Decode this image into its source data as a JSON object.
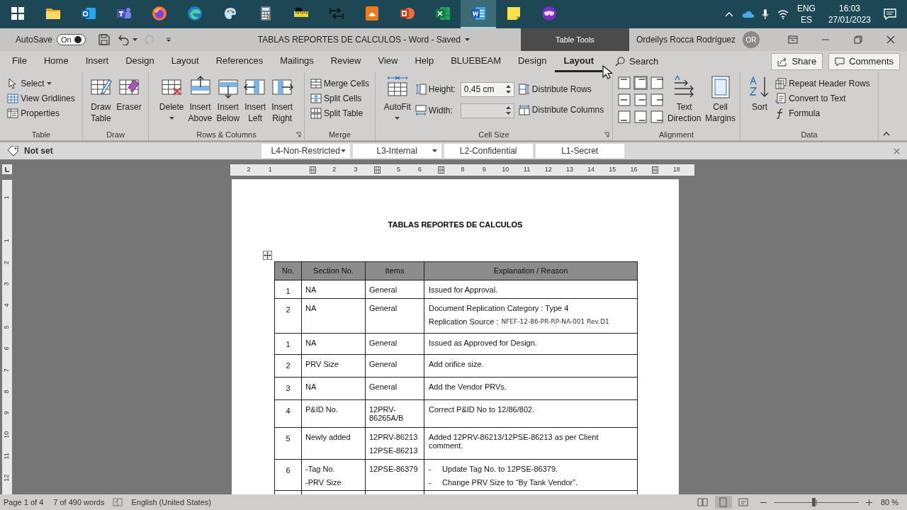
{
  "taskbar": {
    "apps": [
      {
        "kind": "start",
        "selected": false
      },
      {
        "kind": "folder",
        "selected": false
      },
      {
        "kind": "outlook",
        "selected": false
      },
      {
        "kind": "teams",
        "selected": false
      },
      {
        "kind": "firefox",
        "selected": false
      },
      {
        "kind": "edge",
        "selected": false
      },
      {
        "kind": "paint",
        "selected": false
      },
      {
        "kind": "calculator",
        "selected": false
      },
      {
        "kind": "ruler",
        "selected": false
      },
      {
        "kind": "tool",
        "selected": false
      },
      {
        "kind": "pdf",
        "selected": false
      },
      {
        "kind": "powerpoint",
        "selected": false
      },
      {
        "kind": "excel",
        "selected": false
      },
      {
        "kind": "word",
        "selected": true
      },
      {
        "kind": "sticky",
        "selected": false
      },
      {
        "kind": "mask",
        "selected": false
      }
    ],
    "language": "ENG",
    "keyboard": "ES",
    "time": "16:03",
    "date": "27/01/2023"
  },
  "title_bar": {
    "autosave_label": "AutoSave",
    "autosave": {
      "label": "On",
      "on": true
    },
    "title": "TABLAS REPORTES DE CALCULOS - Word - Saved",
    "context_label": "Table Tools",
    "user": "Ordeilys Rocca Rodríguez",
    "initials": "OR"
  },
  "tabs": [
    {
      "label": "File",
      "selected": false
    },
    {
      "label": "Home",
      "selected": false
    },
    {
      "label": "Insert",
      "selected": false
    },
    {
      "label": "Design",
      "selected": false
    },
    {
      "label": "Layout",
      "selected": false
    },
    {
      "label": "References",
      "selected": false
    },
    {
      "label": "Mailings",
      "selected": false
    },
    {
      "label": "Review",
      "selected": false
    },
    {
      "label": "View",
      "selected": false
    },
    {
      "label": "Help",
      "selected": false
    },
    {
      "label": "BLUEBEAM",
      "selected": false
    },
    {
      "label": "Design",
      "selected": false
    },
    {
      "label": "Layout",
      "selected": true
    }
  ],
  "search": {
    "label": "Search"
  },
  "share": "Share",
  "comments": "Comments",
  "ribbon": {
    "groups": [
      {
        "label": "Table",
        "items": [
          {
            "kind": "small",
            "label": "Select",
            "dropdown": true
          },
          {
            "kind": "small",
            "label": "View Gridlines"
          },
          {
            "kind": "small",
            "label": "Properties"
          }
        ]
      },
      {
        "label": "Draw",
        "items": [
          {
            "kind": "large",
            "label": "Draw Table"
          },
          {
            "kind": "large",
            "label": "Eraser"
          }
        ]
      },
      {
        "label": "Rows & Columns",
        "launcher": true,
        "items": [
          {
            "kind": "large",
            "label": "Delete",
            "dropdown": true
          },
          {
            "kind": "large",
            "label": "Insert Above"
          },
          {
            "kind": "large",
            "label": "Insert Below"
          },
          {
            "kind": "large",
            "label": "Insert Left"
          },
          {
            "kind": "large",
            "label": "Insert Right"
          }
        ]
      },
      {
        "label": "Merge",
        "items": [
          {
            "kind": "small",
            "label": "Merge Cells"
          },
          {
            "kind": "small",
            "label": "Split Cells"
          },
          {
            "kind": "small",
            "label": "Split Table"
          }
        ]
      },
      {
        "label": "Cell Size",
        "launcher": true,
        "items": [
          {
            "kind": "large",
            "label": "AutoFit",
            "dropdown": true
          },
          {
            "kind": "field",
            "label": "Height:",
            "value": "0,45 cm"
          },
          {
            "kind": "field",
            "label": "Width:"
          },
          {
            "kind": "small",
            "label": "Distribute Rows"
          },
          {
            "kind": "small",
            "label": "Distribute Columns"
          }
        ]
      },
      {
        "label": "Alignment",
        "items": [
          {
            "kind": "alignment",
            "cells": [
              {
                "selected": false
              },
              {
                "selected": true
              },
              {
                "selected": false
              },
              {
                "selected": false
              },
              {
                "selected": false
              },
              {
                "selected": false
              },
              {
                "selected": false
              },
              {
                "selected": false
              },
              {
                "selected": false
              }
            ]
          },
          {
            "kind": "large",
            "label": "Text Direction"
          },
          {
            "kind": "large",
            "label": "Cell Margins"
          }
        ]
      },
      {
        "label": "Data",
        "items": [
          {
            "kind": "large",
            "label": "Sort"
          },
          {
            "kind": "small",
            "label": "Repeat Header Rows"
          },
          {
            "kind": "small",
            "label": "Convert to Text"
          },
          {
            "kind": "small",
            "label": "Formula"
          }
        ]
      }
    ]
  },
  "sensitivity": {
    "label": "Not set",
    "levels": [
      {
        "label": "L4-Non-Restricted",
        "dropdown": true
      },
      {
        "label": "L3-Internal",
        "dropdown": true
      },
      {
        "label": "L2-Confidential",
        "dropdown": false
      },
      {
        "label": "L1-Secret",
        "dropdown": false
      }
    ]
  },
  "ruler": {
    "horizontal": [
      {
        "kind": "number",
        "label": "2"
      },
      {
        "kind": "number",
        "label": "1"
      },
      {
        "kind": "gap"
      },
      {
        "kind": "marker"
      },
      {
        "kind": "number",
        "label": "2"
      },
      {
        "kind": "number",
        "label": "3"
      },
      {
        "kind": "marker"
      },
      {
        "kind": "number",
        "label": "5"
      },
      {
        "kind": "number",
        "label": "6"
      },
      {
        "kind": "marker"
      },
      {
        "kind": "number",
        "label": "8"
      },
      {
        "kind": "number",
        "label": "9"
      },
      {
        "kind": "number",
        "label": "10"
      },
      {
        "kind": "number",
        "label": "11"
      },
      {
        "kind": "number",
        "label": "12"
      },
      {
        "kind": "number",
        "label": "13"
      },
      {
        "kind": "number",
        "label": "14"
      },
      {
        "kind": "number",
        "label": "15"
      },
      {
        "kind": "number",
        "label": "16"
      },
      {
        "kind": "marker"
      },
      {
        "kind": "number",
        "label": "18"
      }
    ],
    "vertical": [
      {
        "kind": "number",
        "label": "1"
      },
      {
        "kind": "gap"
      },
      {
        "kind": "number",
        "label": "1"
      },
      {
        "kind": "number",
        "label": "2"
      },
      {
        "kind": "number",
        "label": "3"
      },
      {
        "kind": "number",
        "label": "4"
      },
      {
        "kind": "number",
        "label": "5"
      },
      {
        "kind": "number",
        "label": "6"
      },
      {
        "kind": "number",
        "label": "7"
      },
      {
        "kind": "number",
        "label": "8"
      },
      {
        "kind": "number",
        "label": "9"
      },
      {
        "kind": "number",
        "label": "10"
      },
      {
        "kind": "number",
        "label": "11"
      },
      {
        "kind": "number",
        "label": "12"
      }
    ]
  },
  "document": {
    "heading": "TABLAS REPORTES DE CALCULOS",
    "table": {
      "columns": [
        "No.",
        "Section No.",
        "Items",
        "Explanation / Reason"
      ],
      "rows": [
        {
          "no": "1",
          "section": [
            "NA"
          ],
          "items": [
            "General"
          ],
          "explanation": [
            {
              "text": "Issued for Approval."
            }
          ]
        },
        {
          "no": "2",
          "section": [
            "NA"
          ],
          "items": [
            "General"
          ],
          "explanation": [
            {
              "text": "Document Replication Category : Type 4"
            },
            {
              "text": "Replication Source :",
              "reference": "NFEF-12-86-PR-RP-NA-001 Rev.D1"
            }
          ]
        },
        {
          "no": "1",
          "section": [
            "NA"
          ],
          "items": [
            "General"
          ],
          "explanation": [
            {
              "text": "Issued as Approved for Design."
            }
          ]
        },
        {
          "no": "2",
          "section": [
            "PRV Size"
          ],
          "items": [
            "General"
          ],
          "explanation": [
            {
              "text": "Add orifice size."
            }
          ]
        },
        {
          "no": "3",
          "section": [
            "NA"
          ],
          "items": [
            "General"
          ],
          "explanation": [
            {
              "text": "Add the Vendor PRVs."
            }
          ]
        },
        {
          "no": "4",
          "section": [
            "P&ID No."
          ],
          "items": [
            "12PRV-86265A/B"
          ],
          "explanation": [
            {
              "text": "Correct P&ID No to 12/86/802."
            }
          ]
        },
        {
          "no": "5",
          "section": [
            "Newly added"
          ],
          "items": [
            "12PRV-86213",
            "12PSE-86213"
          ],
          "explanation": [
            {
              "text": "Added 12PRV-86213/12PSE-86213 as per Client comment."
            }
          ]
        },
        {
          "no": "6",
          "section": [
            "-Tag No.",
            "-PRV Size"
          ],
          "items": [
            "12PSE-86379"
          ],
          "explanation": [
            {
              "marker": "-",
              "text": "Update Tag No. to 12PSE-86379."
            },
            {
              "marker": "-",
              "text": "Change PRV Size to “By Tank Vendor”."
            }
          ]
        }
      ]
    }
  },
  "status_bar": {
    "page": "Page 1 of 4",
    "words": "7 of 490 words",
    "language": "English (United States)",
    "views": [
      {
        "selected": false
      },
      {
        "selected": true
      },
      {
        "selected": false
      }
    ],
    "zoom": {
      "level": 0.47,
      "label": "80 %"
    }
  }
}
